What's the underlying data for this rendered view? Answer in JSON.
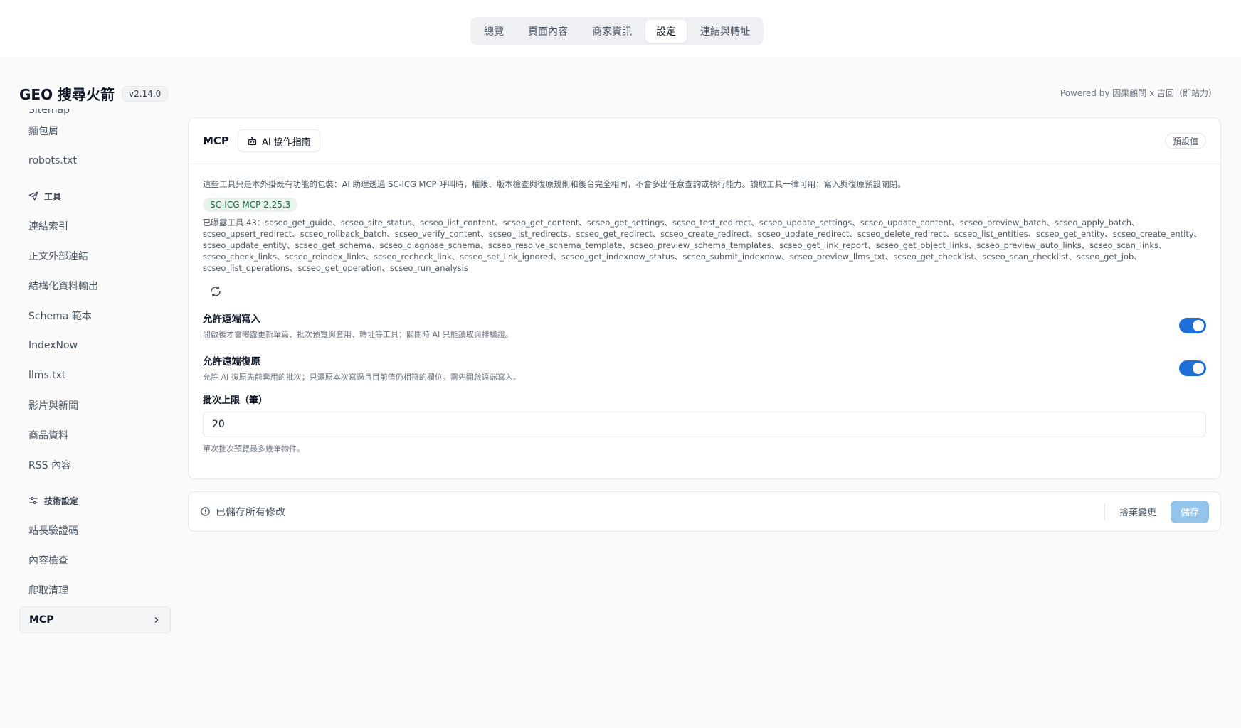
{
  "topnav": {
    "tabs": [
      {
        "label": "總覽"
      },
      {
        "label": "頁面內容"
      },
      {
        "label": "商家資訊"
      },
      {
        "label": "設定"
      },
      {
        "label": "連結與轉址"
      }
    ],
    "active_tab": "設定"
  },
  "brand": {
    "title": "GEO 搜尋火箭",
    "version": "v2.14.0",
    "powered_by": "Powered by 因果顧問 x 吉回（即站力）"
  },
  "sidebar": {
    "items_top": [
      {
        "label": "Sitemap"
      },
      {
        "label": "麵包屑"
      },
      {
        "label": "robots.txt"
      }
    ],
    "tools_heading": "工具",
    "tools_items": [
      {
        "label": "連結索引"
      },
      {
        "label": "正文外部連結"
      },
      {
        "label": "結構化資料輸出"
      },
      {
        "label": "Schema 範本"
      },
      {
        "label": "IndexNow"
      },
      {
        "label": "llms.txt"
      },
      {
        "label": "影片與新聞"
      },
      {
        "label": "商品資料"
      },
      {
        "label": "RSS 內容"
      }
    ],
    "tech_heading": "技術設定",
    "tech_items": [
      {
        "label": "站長驗證碼"
      },
      {
        "label": "內容檢查"
      },
      {
        "label": "爬取清理"
      }
    ],
    "active_item": "MCP"
  },
  "card": {
    "title": "MCP",
    "guide_button": "AI 協作指南",
    "default_button": "預設值",
    "description": "這些工具只是本外掛既有功能的包裝：AI 助理透過 SC-ICG MCP 呼叫時，權限、版本檢查與復原規則和後台完全相同，不會多出任意查詢或執行能力。讀取工具一律可用；寫入與復原預設關閉。",
    "badge": "SC-ICG MCP 2.25.3",
    "tools_text": "已曝露工具 43：scseo_get_guide、scseo_site_status、scseo_list_content、scseo_get_content、scseo_get_settings、scseo_test_redirect、scseo_update_settings、scseo_update_content、scseo_preview_batch、scseo_apply_batch、scseo_upsert_redirect、scseo_rollback_batch、scseo_verify_content、scseo_list_redirects、scseo_get_redirect、scseo_create_redirect、scseo_update_redirect、scseo_delete_redirect、scseo_list_entities、scseo_get_entity、scseo_create_entity、scseo_update_entity、scseo_get_schema、scseo_diagnose_schema、scseo_resolve_schema_template、scseo_preview_schema_templates、scseo_get_link_report、scseo_get_object_links、scseo_preview_auto_links、scseo_scan_links、scseo_check_links、scseo_reindex_links、scseo_recheck_link、scseo_set_link_ignored、scseo_get_indexnow_status、scseo_submit_indexnow、scseo_preview_llms_txt、scseo_get_checklist、scseo_scan_checklist、scseo_get_job、scseo_list_operations、scseo_get_operation、scseo_run_analysis",
    "settings": {
      "remote_write": {
        "label": "允許遠端寫入",
        "help": "開啟後才會曝露更新單篇、批次預覽與套用、轉址等工具；關閉時 AI 只能讀取與排驗證。",
        "enabled": true
      },
      "remote_restore": {
        "label": "允許遠端復原",
        "help": "允許 AI 復原先前套用的批次；只還原本次寫過且目前值仍相符的欄位。需先開啟遠端寫入。",
        "enabled": true
      }
    },
    "batch_limit": {
      "label": "批次上限（筆）",
      "value": "20",
      "help": "單次批次預覽最多幾筆物件。"
    }
  },
  "savebar": {
    "status": "已儲存所有修改",
    "discard": "捨棄變更",
    "save": "儲存"
  },
  "colors": {
    "accent": "#1e6fd9",
    "save_disabled": "#93c5ec",
    "badge_bg": "#e8f5ee",
    "badge_text": "#166534"
  }
}
